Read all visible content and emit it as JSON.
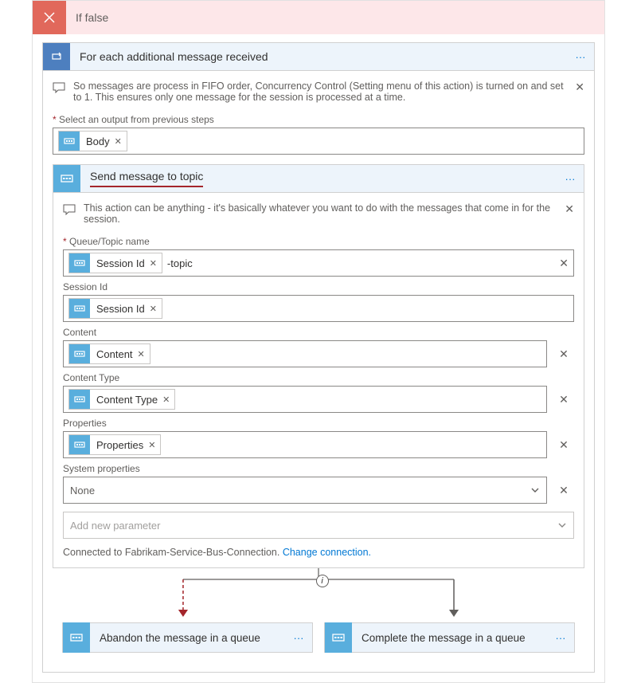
{
  "if_false": {
    "title": "If false"
  },
  "foreach": {
    "title": "For each additional message received",
    "note": "So messages are process in FIFO order, Concurrency Control (Setting menu of this action) is turned on and set to 1. This ensures only one message for the session is processed at a time.",
    "output_label": "Select an output from previous steps",
    "body_token": "Body"
  },
  "send": {
    "title": "Send message to topic",
    "note": "This action can be anything - it's basically whatever you want to do with the messages that come in for the session.",
    "fields": {
      "queue_label": "Queue/Topic name",
      "queue_token": "Session Id",
      "queue_suffix": "-topic",
      "session_label": "Session Id",
      "session_token": "Session Id",
      "content_label": "Content",
      "content_token": "Content",
      "ctype_label": "Content Type",
      "ctype_token": "Content Type",
      "props_label": "Properties",
      "props_token": "Properties",
      "sysprops_label": "System properties",
      "sysprops_value": "None",
      "addparam_placeholder": "Add new parameter"
    },
    "connected_text": "Connected to Fabrikam-Service-Bus-Connection.  ",
    "change_link": "Change connection."
  },
  "branches": {
    "abandon": "Abandon the message in a queue",
    "complete": "Complete the message in a queue"
  }
}
